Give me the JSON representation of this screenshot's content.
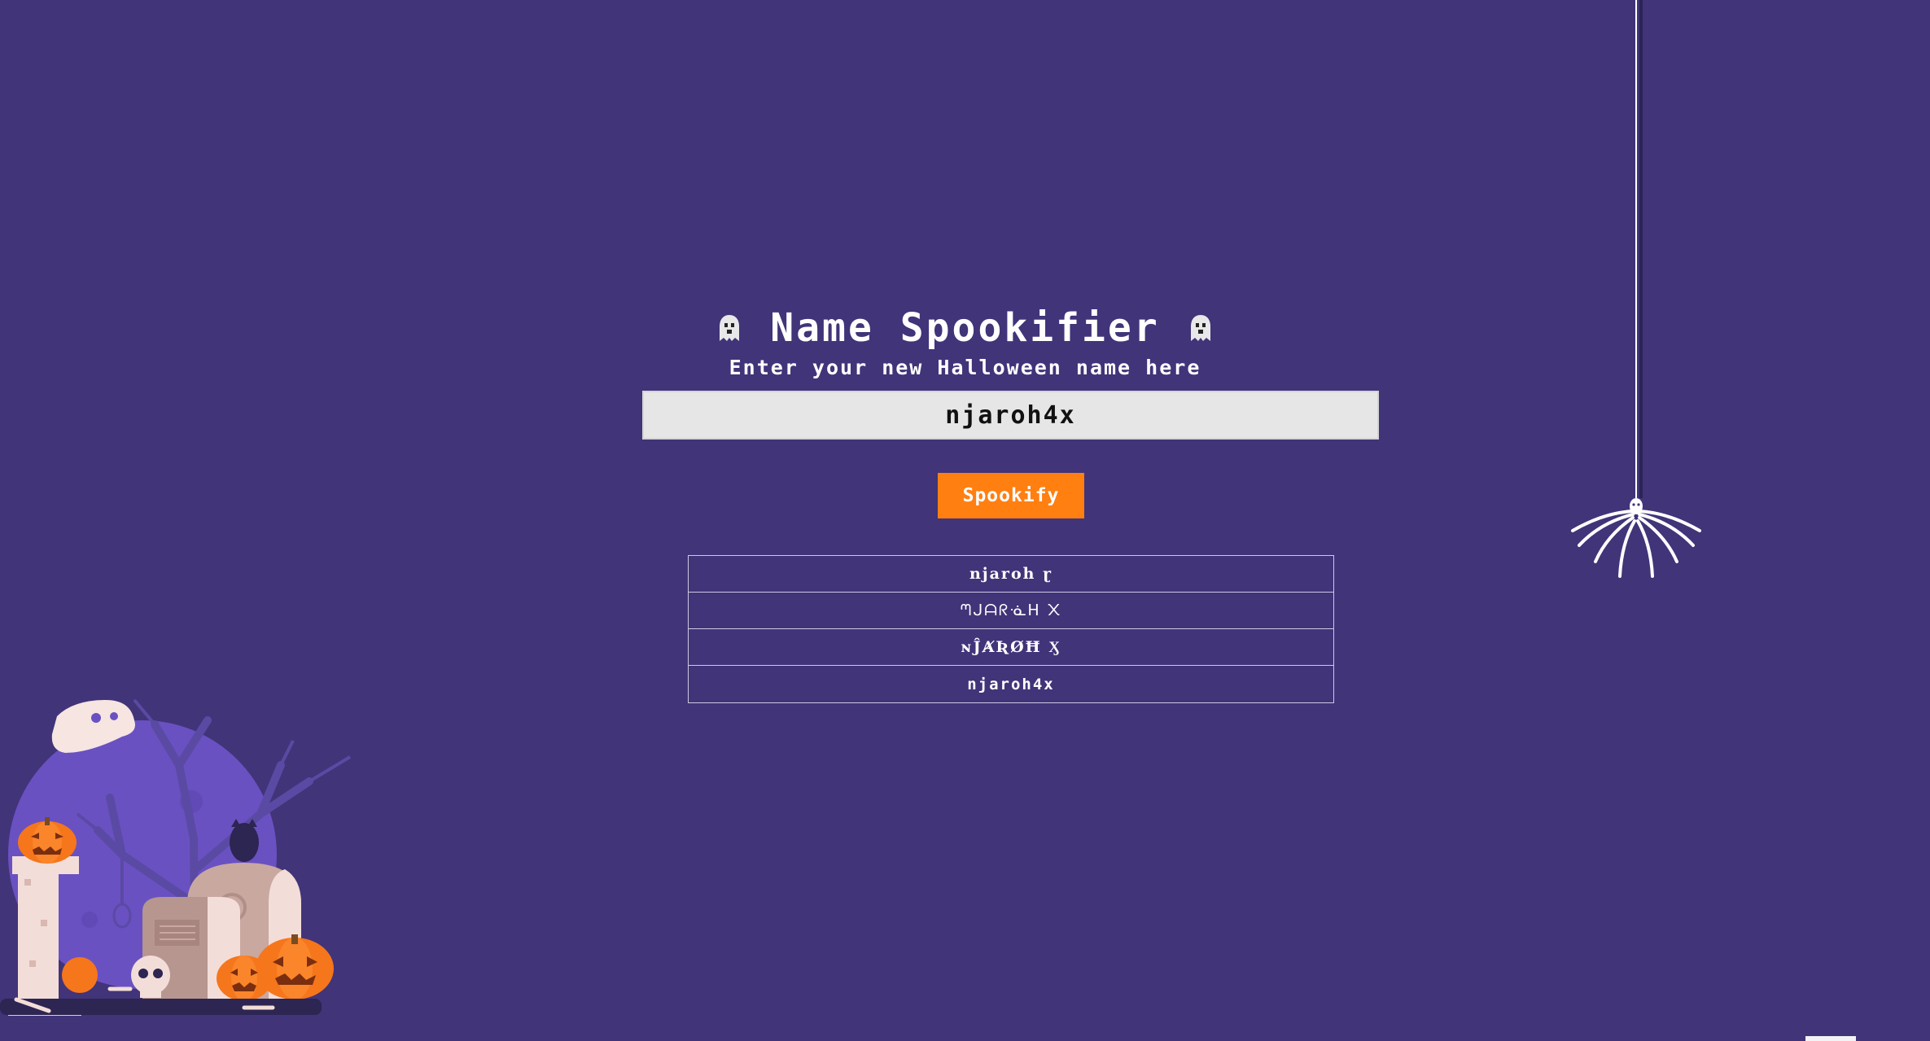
{
  "header": {
    "title": "Name Spookifier",
    "subtitle": "Enter your new Halloween name here"
  },
  "form": {
    "input_value": "njaroh4x",
    "submit_label": "Spookify"
  },
  "results": [
    {
      "text": "njaroh  ɽ"
    },
    {
      "text": "ᘉᒍᗩᖇᓍᕼ  ᙭"
    },
    {
      "text": "ɴĴȺƦØĦ  Ӽ"
    },
    {
      "text": "njaroh4x"
    }
  ],
  "icons": {
    "title_left": "ghost-icon",
    "title_right": "ghost-icon",
    "decor_top_right": "spider-icon",
    "decor_bottom_left": "graveyard-illustration"
  },
  "colors": {
    "background": "#413479",
    "button": "#ff7f11",
    "input_bg": "#e6e6e6"
  }
}
